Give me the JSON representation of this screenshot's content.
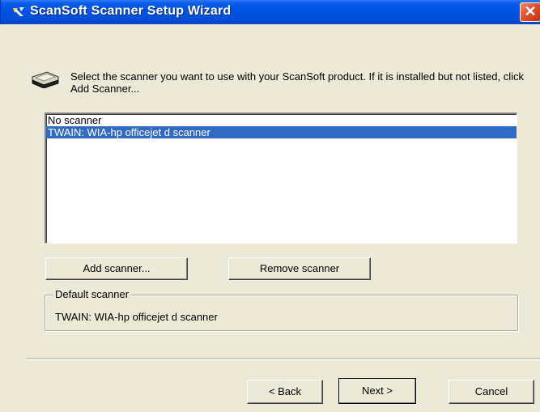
{
  "window": {
    "title": "ScanSoft Scanner Setup Wizard",
    "close_label": "✕",
    "app_icon": "scansoft-wizard-icon"
  },
  "instructions": {
    "text": "Select the scanner you want to use with your ScanSoft product. If it is installed but not listed, click Add Scanner...",
    "icon": "scanner-icon"
  },
  "scanner_list": {
    "items": [
      {
        "label": "No scanner",
        "selected": false
      },
      {
        "label": "TWAIN: WIA-hp officejet d scanner",
        "selected": true
      }
    ]
  },
  "buttons": {
    "add_scanner": "Add scanner...",
    "remove_scanner": "Remove scanner",
    "back": "< Back",
    "next": "Next >",
    "cancel": "Cancel"
  },
  "default_scanner": {
    "legend": "Default scanner",
    "value": "TWAIN: WIA-hp officejet d scanner"
  },
  "colors": {
    "titlebar": "#0054e3",
    "selection": "#316ac5",
    "dialog_bg": "#ece9d8"
  }
}
